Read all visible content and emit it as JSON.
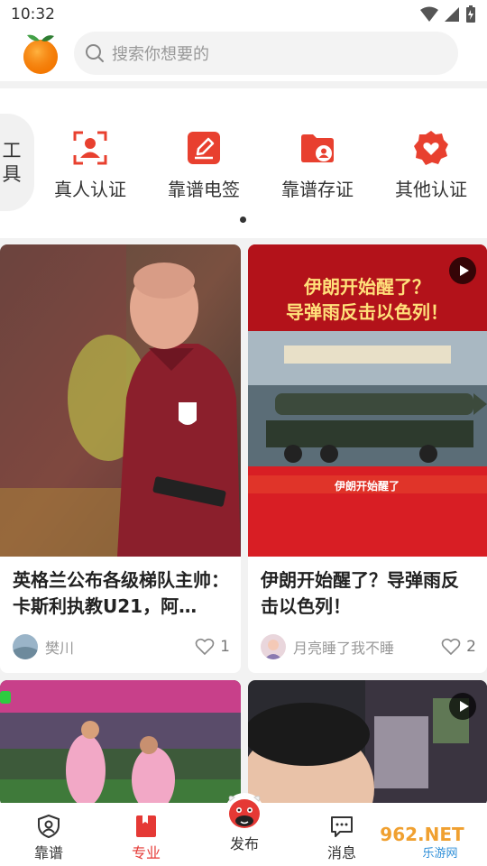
{
  "status": {
    "time": "10:32"
  },
  "search": {
    "placeholder": "搜索你想要的"
  },
  "tools": {
    "tab_label": [
      "工",
      "具"
    ],
    "items": [
      {
        "label": "真人认证",
        "icon": "face-scan-icon"
      },
      {
        "label": "靠谱电签",
        "icon": "pen-sign-icon"
      },
      {
        "label": "靠谱存证",
        "icon": "folder-user-icon"
      },
      {
        "label": "其他认证",
        "icon": "badge-heart-icon"
      }
    ]
  },
  "feed": [
    {
      "title": "英格兰公布各级梯队主帅：卡斯利执教U21，阿…",
      "author": "樊川",
      "likes": "1",
      "video": false
    },
    {
      "title": "伊朗开始醒了？导弹雨反击以色列！",
      "author": "月亮睡了我不睡",
      "likes": "2",
      "video": true,
      "thumb_headline": [
        "伊朗开始醒了？",
        "导弹雨反击以色列！"
      ],
      "thumb_caption": "伊朗开始醒了"
    }
  ],
  "nav": {
    "items": [
      {
        "label": "靠谱",
        "icon": "shield-user-icon"
      },
      {
        "label": "专业",
        "icon": "book-icon"
      },
      {
        "label": "发布",
        "icon": "bull-mascot-icon"
      },
      {
        "label": "消息",
        "icon": "chat-icon"
      }
    ]
  },
  "watermark": {
    "text": "962.NET",
    "subtext": "乐游网"
  },
  "colors": {
    "accent": "#e53935",
    "tool_red": "#e8402f"
  }
}
